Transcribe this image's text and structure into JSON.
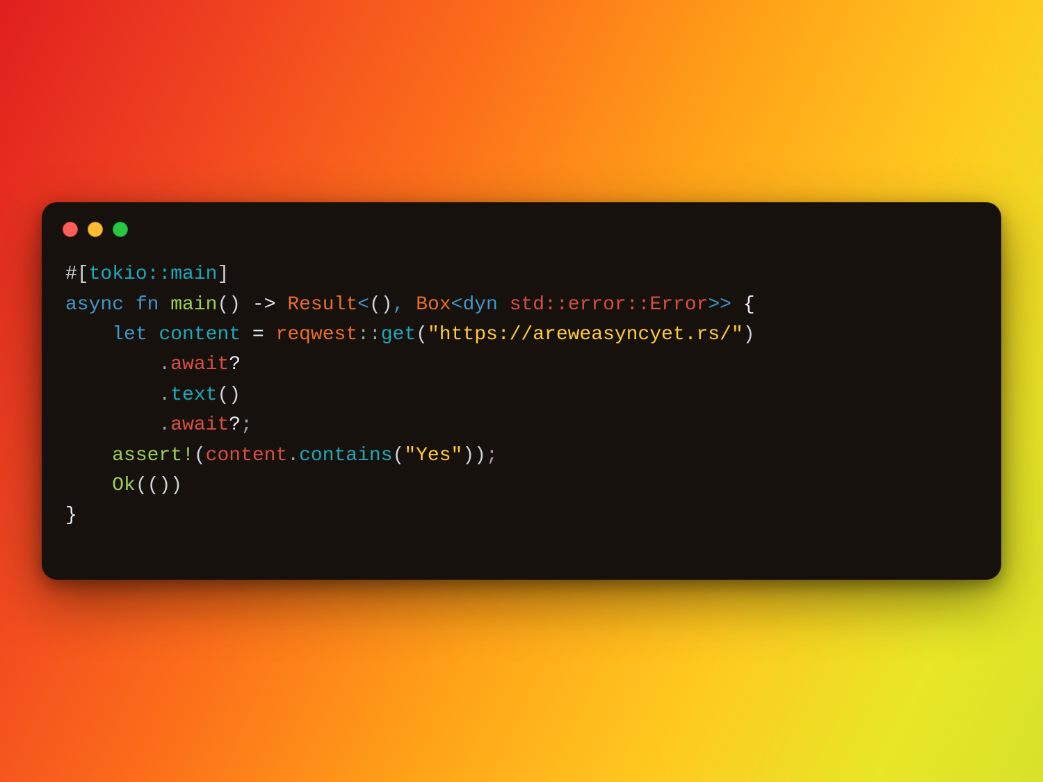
{
  "code": {
    "l1": {
      "hash": "#",
      "lb": "[",
      "attr": "tokio::main",
      "rb": "]"
    },
    "l2": {
      "async": "async",
      "fn": "fn",
      "main": "main",
      "lp": "(",
      "rp": ")",
      "arrow": "->",
      "result": "Result",
      "lt1": "<",
      "lp2": "(",
      "rp2": ")",
      "comma": ",",
      "box": "Box",
      "lt2": "<",
      "dyn": "dyn",
      "errpath": "std::error::Error",
      "gt2": ">",
      "gt1": ">",
      "lbrace": "{"
    },
    "l3": {
      "let": "let",
      "content": "content",
      "eq": "=",
      "reqwest": "reqwest",
      "cc": "::",
      "get": "get",
      "lp": "(",
      "url": "\"https://areweasyncyet.rs/\"",
      "rp": ")"
    },
    "l4": {
      "dot": ".",
      "await": "await",
      "q": "?"
    },
    "l5": {
      "dot": ".",
      "text": "text",
      "lp": "(",
      "rp": ")"
    },
    "l6": {
      "dot": ".",
      "await": "await",
      "q": "?",
      "semi": ";"
    },
    "l7": {
      "assert": "assert!",
      "lp": "(",
      "content": "content",
      "dot": ".",
      "contains": "contains",
      "lp2": "(",
      "yes": "\"Yes\"",
      "rp2": ")",
      "rp": ")",
      "semi": ";"
    },
    "l8": {
      "ok": "Ok",
      "lp": "(",
      "lp2": "(",
      "rp2": ")",
      "rp": ")"
    },
    "l9": {
      "rbrace": "}"
    }
  }
}
